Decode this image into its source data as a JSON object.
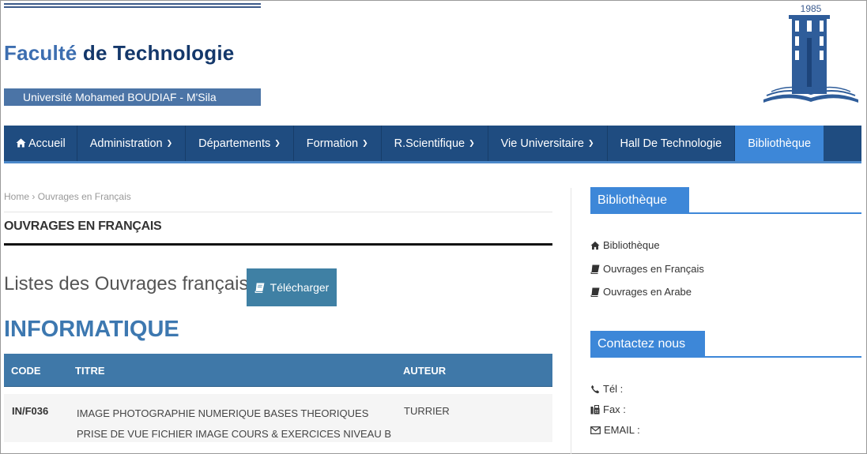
{
  "header": {
    "title_part1": "Faculté",
    "title_part2": "de Technologie",
    "university": "Université  Mohamed BOUDIAF - M'Sila",
    "logo_year": "1985"
  },
  "nav": {
    "items": [
      {
        "label": "Accueil",
        "icon": "home-icon",
        "dropdown": false
      },
      {
        "label": "Administration",
        "dropdown": true
      },
      {
        "label": "Départements",
        "dropdown": true
      },
      {
        "label": "Formation",
        "dropdown": true
      },
      {
        "label": "R.Scientifique",
        "dropdown": true
      },
      {
        "label": "Vie Universitaire",
        "dropdown": true
      },
      {
        "label": "Hall De Technologie",
        "dropdown": false
      },
      {
        "label": "Bibliothèque",
        "dropdown": false,
        "active": true
      }
    ]
  },
  "breadcrumb": {
    "home": "Home",
    "separator": "›",
    "current": "Ouvrages en Français"
  },
  "page": {
    "title": "OUVRAGES EN FRANÇAIS",
    "lists_title": "Listes des Ouvrages français",
    "download_label": "Télécharger",
    "section_title": "INFORMATIQUE"
  },
  "table": {
    "headers": {
      "code": "CODE",
      "title": "TITRE",
      "author": "AUTEUR"
    },
    "rows": [
      {
        "code": "IN/F036",
        "title": "IMAGE PHOTOGRAPHIE NUMERIQUE BASES THEORIQUES PRISE DE VUE FICHIER IMAGE COURS & EXERCICES NIVEAU B",
        "author": "TURRIER"
      }
    ]
  },
  "sidebar": {
    "widget1_title": "Bibliothèque",
    "links": [
      {
        "label": "Bibliothèque",
        "icon": "home-icon"
      },
      {
        "label": "Ouvrages en Français",
        "icon": "book-icon"
      },
      {
        "label": "Ouvrages en Arabe",
        "icon": "book-icon"
      }
    ],
    "widget2_title": "Contactez nous",
    "contact": {
      "tel_label": "Tél :",
      "fax_label": "Fax :",
      "email_label": "EMAIL :"
    }
  },
  "colors": {
    "nav_bg": "#1f4c80",
    "nav_active": "#3d87d8",
    "table_header": "#3f78a8",
    "download_button": "#3f80a4",
    "section_title": "#3d78b0"
  }
}
